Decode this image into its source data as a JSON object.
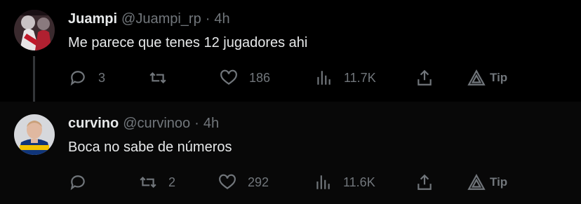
{
  "posts": [
    {
      "name": "Juampi",
      "handle": "@Juampi_rp",
      "separator": "·",
      "time": "4h",
      "text": "Me parece que tenes 12 jugadores ahi",
      "replies": "3",
      "reposts": "",
      "likes": "186",
      "views": "11.7K",
      "tip": "Tip"
    },
    {
      "name": "curvino",
      "handle": "@curvinoo",
      "separator": "·",
      "time": "4h",
      "text": "Boca no sabe de números",
      "replies": "",
      "reposts": "2",
      "likes": "292",
      "views": "11.6K",
      "tip": "Tip"
    }
  ],
  "icons": [
    "reply-icon",
    "repost-icon",
    "like-icon",
    "views-icon",
    "share-icon",
    "tip-icon"
  ],
  "colors": {
    "background": "#000000",
    "text": "#e7e9ea",
    "muted": "#71767b",
    "thread_line": "#333639"
  }
}
